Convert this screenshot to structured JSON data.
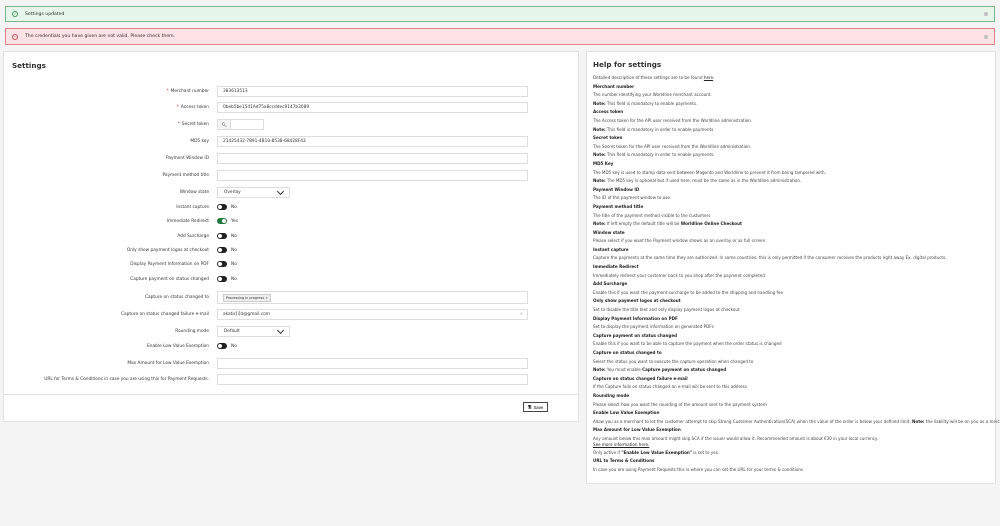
{
  "banners": {
    "success": "Settings updated",
    "error": "The credentials you have given are not valid. Please check them."
  },
  "settings": {
    "title": "Settings",
    "save_label": "Save",
    "rows": [
      {
        "label": "Merchant number",
        "required": true,
        "type": "text",
        "value": "383613513"
      },
      {
        "label": "Access token",
        "required": true,
        "type": "text",
        "value": "0beb5be1541Ad75a8ccddec9147b3089"
      },
      {
        "label": "Secret token",
        "required": true,
        "type": "secret",
        "value": ""
      },
      {
        "label": "MD5 key",
        "required": false,
        "type": "text",
        "value": "21425432-7891-4B10-8538-68428F43"
      },
      {
        "label": "Payment Window ID",
        "required": false,
        "type": "text",
        "value": ""
      },
      {
        "label": "Payment method title",
        "required": false,
        "type": "text",
        "value": ""
      },
      {
        "label": "Window state",
        "required": false,
        "type": "select",
        "value": "Overlay"
      },
      {
        "label": "Instant capture",
        "required": false,
        "type": "toggle",
        "on": false,
        "value": "No"
      },
      {
        "label": "Immediate Redirect",
        "required": false,
        "type": "toggle",
        "on": true,
        "value": "Yes"
      },
      {
        "label": "Add Surcharge",
        "required": false,
        "type": "toggle",
        "on": false,
        "value": "No"
      },
      {
        "label": "Only show payment logos at checkout",
        "required": false,
        "type": "toggle",
        "on": false,
        "value": "No"
      },
      {
        "label": "Display Payment Information on PDF",
        "required": false,
        "type": "toggle",
        "on": false,
        "value": "No"
      },
      {
        "label": "Capture payment on status changed",
        "required": false,
        "type": "toggle",
        "on": false,
        "value": "No"
      },
      {
        "label": "Capture on status changed to",
        "required": false,
        "type": "tags",
        "tags": [
          "Processing in progress"
        ]
      },
      {
        "label": "Capture on status changed failure e-mail",
        "required": false,
        "type": "email",
        "value": "akatic[i]d@gmail.com"
      },
      {
        "label": "Rounding mode",
        "required": false,
        "type": "select",
        "value": "Default"
      },
      {
        "label": "Enable Low Value Exemption",
        "required": false,
        "type": "toggle",
        "on": false,
        "value": "No"
      },
      {
        "label": "Max Amount for Low Value Exemption",
        "required": false,
        "type": "text",
        "value": ""
      },
      {
        "label": "URL for Terms & Conditions in case you are using this for Payment Requests.",
        "required": false,
        "type": "text",
        "value": ""
      }
    ]
  },
  "help": {
    "title": "Help for settings",
    "intro": [
      {
        "t": "Detailed description of these settings are to be found "
      },
      {
        "t": "here",
        "link": true
      },
      {
        "t": "."
      }
    ],
    "sections": [
      {
        "title": "Merchant number",
        "paras": [
          [
            {
              "t": "The number identifying your Worldline merchant account."
            }
          ],
          [
            {
              "t": "Note:",
              "b": true
            },
            {
              "t": " This field is mandatory to enable payments."
            }
          ]
        ]
      },
      {
        "title": "Access token",
        "paras": [
          [
            {
              "t": "The Access token for the API user received from the Worldline administration."
            }
          ],
          [
            {
              "t": "Note:",
              "b": true
            },
            {
              "t": " This field is mandatory in order to enable payments"
            }
          ]
        ]
      },
      {
        "title": "Secret token",
        "paras": [
          [
            {
              "t": "The Secret token for the API user received from the Worldline administration."
            }
          ],
          [
            {
              "t": "Note:",
              "b": true
            },
            {
              "t": " This field is mandatory in order to enable payments."
            }
          ]
        ]
      },
      {
        "title": "MD5 Key",
        "paras": [
          [
            {
              "t": "The MD5 key is used to stamp data sent between Magento and Worldline to prevent it from being tampered with."
            }
          ],
          [
            {
              "t": "Note:",
              "b": true
            },
            {
              "t": " The MD5 key is optional but if used here, must be the same as in the Worldline administration."
            }
          ]
        ]
      },
      {
        "title": "Payment Window ID",
        "paras": [
          [
            {
              "t": "The ID of the payment window to use."
            }
          ]
        ]
      },
      {
        "title": "Payment method title",
        "paras": [
          [
            {
              "t": "The title of the payment method visible to the customers"
            }
          ],
          [
            {
              "t": "Note:",
              "b": true
            },
            {
              "t": " If left empty the default title will be "
            },
            {
              "t": "Worldline Online Checkout",
              "b": true
            }
          ]
        ]
      },
      {
        "title": "Window state",
        "paras": [
          [
            {
              "t": "Please select if you want the Payment window shown as an overlay or as full screen"
            }
          ]
        ]
      },
      {
        "title": "Instant capture",
        "paras": [
          [
            {
              "t": "Capture the payments at the same time they are authorized. In some countries, this is only permitted if the consumer receives the products right away Ex. digital products."
            }
          ]
        ]
      },
      {
        "title": "Immediate Redirect",
        "paras": [
          [
            {
              "t": "Immediately redirect your customer back to you shop after the payment completed."
            }
          ]
        ]
      },
      {
        "title": "Add Surcharge",
        "paras": [
          [
            {
              "t": "Enable this if you want the payment surcharge to be added to the shipping and handling fee"
            }
          ]
        ]
      },
      {
        "title": "Only show payment logos at checkout",
        "paras": [
          [
            {
              "t": "Set to disable the title text and only display payment logos at checkout"
            }
          ]
        ]
      },
      {
        "title": "Display Payment Information on PDF",
        "paras": [
          [
            {
              "t": "Set to display the payment information on generated PDFs"
            }
          ]
        ]
      },
      {
        "title": "Capture payment on status changed",
        "paras": [
          [
            {
              "t": "Enable this if you want to be able to capture the payment when the order status is changed"
            }
          ]
        ]
      },
      {
        "title": "Capture on status changed to",
        "paras": [
          [
            {
              "t": "Select the status you want to execute the capture operation when changed to"
            }
          ],
          [
            {
              "t": "Note:",
              "b": true
            },
            {
              "t": " You must enable "
            },
            {
              "t": "Capture payment on status changed",
              "b": true
            }
          ]
        ]
      },
      {
        "title": "Capture on status changed failure e-mail",
        "paras": [
          [
            {
              "t": "If the Capture fails on status changed an e-mail will be sent to this address"
            }
          ]
        ]
      },
      {
        "title": "Rounding mode",
        "paras": [
          [
            {
              "t": "Please select how you want the rounding of the amount sent to the payment system"
            }
          ]
        ]
      },
      {
        "title": "Enable Low Value Exemption",
        "paras": [
          [
            {
              "t": "Allow you as a merchant to let the customer attempt to skip Strong Customer Authentication(SCA) when the value of the order is below your defined limit. "
            },
            {
              "t": "Note:",
              "b": true
            },
            {
              "t": " the liability will be on you as a merchant."
            }
          ]
        ]
      },
      {
        "title": "Max Amount for Low Value Exemption",
        "paras": [
          [
            {
              "t": "Any amount below this max amount might skip SCA if the issuer would allow it. Recommended amount is about €30 in your local currency."
            },
            {
              "t": "See more information here.",
              "link": true,
              "tight": true
            }
          ],
          [
            {
              "t": "Only active if "
            },
            {
              "t": "\"Enable Low Value Exemption\"",
              "b": true
            },
            {
              "t": " is set to yes."
            }
          ]
        ]
      },
      {
        "title": "URL to Terms & Conditions",
        "paras": [
          [
            {
              "t": "In case you are using Payment Requests this is where you can set the URL for your terms & conditions"
            }
          ]
        ]
      }
    ]
  }
}
